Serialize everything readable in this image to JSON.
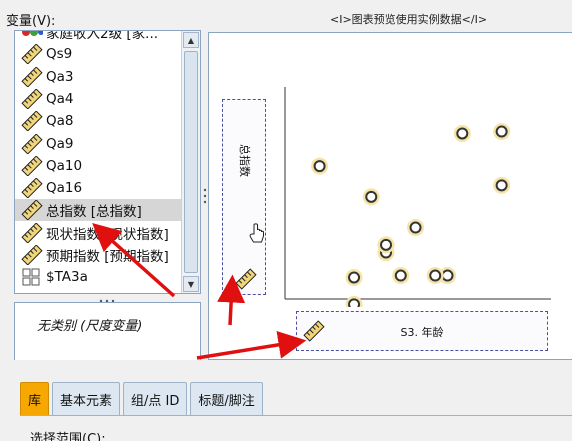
{
  "header": {
    "variables_label": "变量(V):",
    "preview_caption": "<I>图表预览使用实例数据</I>"
  },
  "variables": [
    {
      "label": "家庭收入2级 [家...",
      "icon": "nominal-balls-icon"
    },
    {
      "label": "Qs9",
      "icon": "scale-ruler-icon"
    },
    {
      "label": "Qa3",
      "icon": "scale-ruler-icon"
    },
    {
      "label": "Qa4",
      "icon": "scale-ruler-icon"
    },
    {
      "label": "Qa8",
      "icon": "scale-ruler-icon"
    },
    {
      "label": "Qa9",
      "icon": "scale-ruler-icon"
    },
    {
      "label": "Qa10",
      "icon": "scale-ruler-icon"
    },
    {
      "label": "Qa16",
      "icon": "scale-ruler-icon"
    },
    {
      "label": "总指数 [总指数]",
      "icon": "scale-ruler-icon",
      "selected": true
    },
    {
      "label": "现状指数 [现状指数]",
      "icon": "scale-ruler-icon"
    },
    {
      "label": "预期指数 [预期指数]",
      "icon": "scale-ruler-icon"
    },
    {
      "label": "$TA3a",
      "icon": "multiple-response-set-icon"
    }
  ],
  "category_panel": {
    "text": "无类别 (尺度变量)"
  },
  "chart_preview": {
    "y_axis_variable": "总指数",
    "x_axis_variable": "S3. 年龄"
  },
  "chart_data": {
    "type": "scatter",
    "x": [
      0.1,
      0.31,
      0.37,
      0.37,
      0.43,
      0.49,
      0.68,
      0.84,
      0.84,
      0.24,
      0.24,
      0.62,
      0.57
    ],
    "y": [
      0.64,
      0.48,
      0.19,
      0.23,
      0.07,
      0.32,
      0.81,
      0.82,
      0.54,
      0.06,
      -0.08,
      0.07,
      0.07
    ],
    "xlim": [
      0,
      1
    ],
    "ylim": [
      0,
      1
    ]
  },
  "tabs": [
    {
      "label": "库",
      "active": true
    },
    {
      "label": "基本元素"
    },
    {
      "label": "组/点 ID"
    },
    {
      "label": "标题/脚注"
    }
  ],
  "bottom": {
    "label": "选择范围(C):"
  },
  "colors": {
    "tab_active": "#f6a800",
    "annotation_arrow": "#e01010",
    "drop_zone_border": "#4a4fa0",
    "point_halo": "#f6e3a6"
  }
}
